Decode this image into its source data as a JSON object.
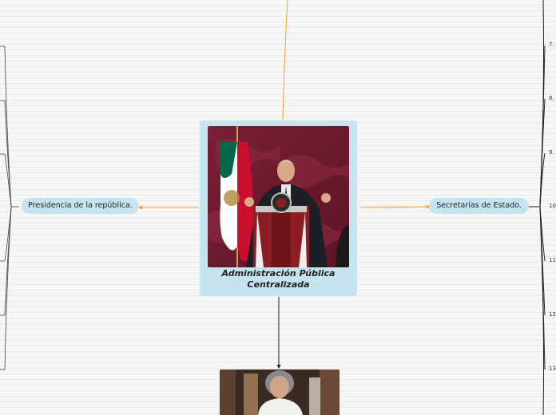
{
  "central_node": {
    "title_line1": "Administración Pública",
    "title_line2": "Centralizada",
    "photo": "president-at-podium-photo"
  },
  "left_node": {
    "label": "Presidencia de la república."
  },
  "right_node": {
    "label": "Secretarías de Estado."
  },
  "bottom_node": {
    "photo": "woman-portrait-photo"
  },
  "right_items": [
    "7.",
    "8.",
    "9.",
    "10",
    "11",
    "12",
    "13"
  ],
  "left_items": [
    "",
    "",
    "",
    "",
    "",
    "",
    "",
    ""
  ],
  "colors": {
    "background": "#f6f6f6",
    "node_fill": "#c6e3ef",
    "orange_connector": "#f0a030",
    "dark_connector": "#222222"
  }
}
